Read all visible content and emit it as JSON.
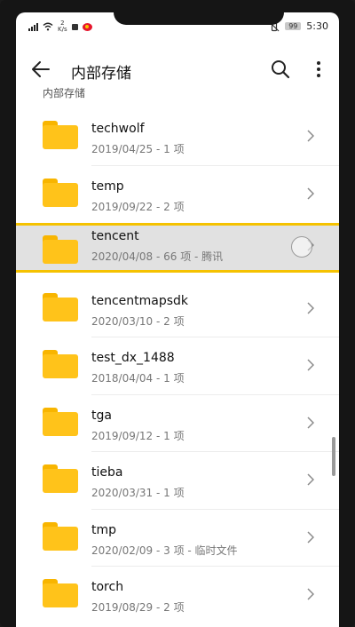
{
  "status_bar": {
    "speed_value": "2",
    "speed_unit": "K/s",
    "battery": "99",
    "time": "5:30"
  },
  "app_bar": {
    "title": "内部存储",
    "icons": [
      "back-arrow-icon",
      "search-icon",
      "more-vert-icon"
    ]
  },
  "breadcrumb": "内部存储",
  "accent_colors": {
    "folder": "#ffc31a",
    "highlight_border": "#f5c200"
  },
  "files": [
    {
      "name": "techwolf",
      "meta": "2019/04/25 - 1 项"
    },
    {
      "name": "temp",
      "meta": "2019/09/22 - 2 项"
    },
    {
      "name": "tencent",
      "meta": "2020/04/08 - 66 项 - 腾讯",
      "highlighted": true
    },
    {
      "name": "tencentmapsdk",
      "meta": "2020/03/10 - 2 项"
    },
    {
      "name": "test_dx_1488",
      "meta": "2018/04/04 - 1 项"
    },
    {
      "name": "tga",
      "meta": "2019/09/12 - 1 项"
    },
    {
      "name": "tieba",
      "meta": "2020/03/31 - 1 项"
    },
    {
      "name": "tmp",
      "meta": "2020/02/09 - 3 项 - 临时文件"
    },
    {
      "name": "torch",
      "meta": "2019/08/29 - 2 项"
    }
  ]
}
